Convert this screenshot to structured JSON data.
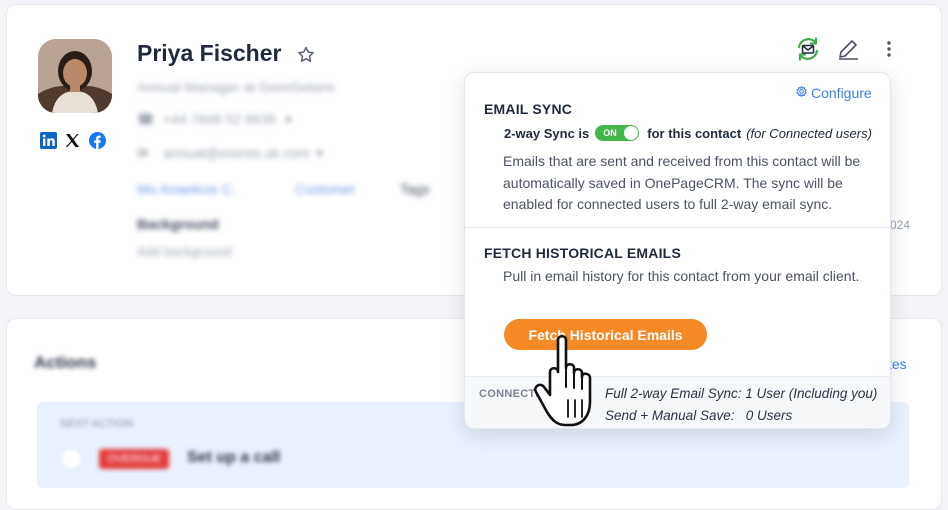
{
  "contact": {
    "name": "Priya Fischer",
    "job": "Annual Manager at DomiSelaris",
    "phone": "+44 7846 52 8635",
    "email": "annual@events.uk.com",
    "owner": "Mo Anaeleze C.",
    "status": "Customer",
    "tags_label": "Tags",
    "background_label": "Background",
    "background_placeholder": "Add background",
    "date_fragment": "024"
  },
  "actions": {
    "title": "Actions",
    "next_action_label": "NEXT ACTION",
    "next_action_badge": "OVERDUE",
    "next_action_text": "Set up a call",
    "right_link": "tes"
  },
  "popup": {
    "configure_label": "Configure",
    "email_sync_title": "EMAIL SYNC",
    "sync_prefix": "2-way Sync is",
    "toggle_label": "ON",
    "sync_suffix": "for this contact",
    "sync_note": "(for Connected users)",
    "sync_description": "Emails that are sent and received from this contact will be automatically saved in OnePageCRM. The sync will be enabled for connected users to full 2-way email sync.",
    "fetch_title": "FETCH HISTORICAL EMAILS",
    "fetch_description": "Pull in email history for this contact from your email client.",
    "fetch_button": "Fetch Historical Emails",
    "footer_label": "CONNECTED",
    "footer_line1": "Full 2-way Email Sync: 1 User (Including you)",
    "footer_line2": "Send + Manual Save:   0 Users"
  },
  "icons": {
    "sync": "email-sync-icon",
    "edit": "pencil-icon",
    "more": "more-vertical-icon",
    "star": "star-outline-icon",
    "linkedin": "linkedin-icon",
    "x": "x-icon",
    "facebook": "facebook-icon",
    "configure": "gear-icon",
    "cursor": "hand-pointer-icon"
  },
  "colors": {
    "accent_blue": "#3d7ee8",
    "toggle_green": "#43b649",
    "button_orange": "#f58a24",
    "sync_icon_green": "#3fae4a"
  }
}
